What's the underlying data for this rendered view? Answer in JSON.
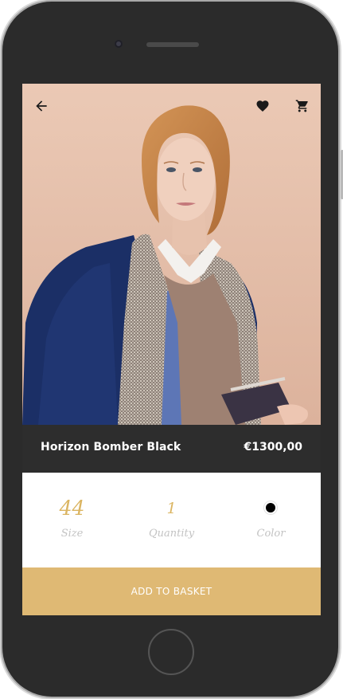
{
  "product": {
    "name": "Horizon Bomber Black",
    "price": "€1300,00"
  },
  "options": [
    {
      "label": "Size",
      "value": "44"
    },
    {
      "label": "Quantity",
      "value": "1"
    },
    {
      "label": "Color",
      "value_color": "#000000"
    }
  ],
  "actions": {
    "add_to_basket": "ADD TO BASKET"
  },
  "icons": {
    "back": "arrow-left-icon",
    "favorite": "heart-icon",
    "cart": "cart-icon"
  },
  "colors": {
    "accent": "#dfb974",
    "dark_bar": "#2d2d2d",
    "device": "#2b2b2b",
    "label": "#c3c3c3"
  }
}
